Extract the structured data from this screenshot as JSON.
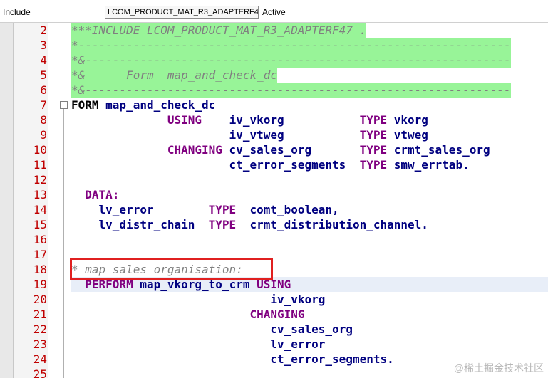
{
  "header": {
    "label": "Include",
    "include_name": "LCOM_PRODUCT_MAT_R3_ADAPTERF47",
    "status": "Active"
  },
  "lines": [
    {
      "num": "2",
      "segments": [
        {
          "t": "***INCLUDE LCOM_PRODUCT_MAT_R3_ADAPTERF47 .",
          "c": "cm"
        }
      ]
    },
    {
      "num": "3",
      "segments": [
        {
          "t": "*---------------------------------------------------------------",
          "c": "cm"
        }
      ]
    },
    {
      "num": "4",
      "segments": [
        {
          "t": "*&--------------------------------------------------------------",
          "c": "cm"
        }
      ]
    },
    {
      "num": "5",
      "segments": [
        {
          "t": "*&      Form  map_and_check_dc",
          "c": "cm"
        }
      ]
    },
    {
      "num": "6",
      "segments": [
        {
          "t": "*&--------------------------------------------------------------",
          "c": "cm"
        }
      ]
    },
    {
      "num": "7",
      "segments": [
        {
          "t": "FORM",
          "c": "kwb"
        },
        {
          "t": " map_and_check_dc",
          "c": "id"
        }
      ]
    },
    {
      "num": "8",
      "segments": [
        {
          "t": "              USING",
          "c": "kw"
        },
        {
          "t": "    iv_vkorg           ",
          "c": "id"
        },
        {
          "t": "TYPE",
          "c": "kw"
        },
        {
          "t": " vkorg",
          "c": "id"
        }
      ]
    },
    {
      "num": "9",
      "segments": [
        {
          "t": "                       iv_vtweg           ",
          "c": "id"
        },
        {
          "t": "TYPE",
          "c": "kw"
        },
        {
          "t": " vtweg",
          "c": "id"
        }
      ]
    },
    {
      "num": "10",
      "segments": [
        {
          "t": "              CHANGING",
          "c": "kw"
        },
        {
          "t": " cv_sales_org       ",
          "c": "id"
        },
        {
          "t": "TYPE",
          "c": "kw"
        },
        {
          "t": " crmt_sales_org",
          "c": "id"
        }
      ]
    },
    {
      "num": "11",
      "segments": [
        {
          "t": "                       ct_error_segments  ",
          "c": "id"
        },
        {
          "t": "TYPE",
          "c": "kw"
        },
        {
          "t": " smw_errtab.",
          "c": "id"
        }
      ]
    },
    {
      "num": "12",
      "segments": []
    },
    {
      "num": "13",
      "segments": [
        {
          "t": "  DATA:",
          "c": "kw"
        }
      ]
    },
    {
      "num": "14",
      "segments": [
        {
          "t": "    lv_error        ",
          "c": "id"
        },
        {
          "t": "TYPE",
          "c": "kw"
        },
        {
          "t": "  comt_boolean,",
          "c": "id"
        }
      ]
    },
    {
      "num": "15",
      "segments": [
        {
          "t": "    lv_distr_chain  ",
          "c": "id"
        },
        {
          "t": "TYPE",
          "c": "kw"
        },
        {
          "t": "  crmt_distribution_channel.",
          "c": "id"
        }
      ]
    },
    {
      "num": "16",
      "segments": []
    },
    {
      "num": "17",
      "segments": []
    },
    {
      "num": "18",
      "segments": [
        {
          "t": "* map sales organisation:",
          "c": "cm"
        }
      ]
    },
    {
      "num": "19",
      "segments": [
        {
          "t": "  PERFORM",
          "c": "kw"
        },
        {
          "t": " map_vkorg_to_crm ",
          "c": "id"
        },
        {
          "t": "USING",
          "c": "kw"
        }
      ]
    },
    {
      "num": "20",
      "segments": [
        {
          "t": "                             iv_vkorg",
          "c": "id"
        }
      ]
    },
    {
      "num": "21",
      "segments": [
        {
          "t": "                          CHANGING",
          "c": "kw"
        }
      ]
    },
    {
      "num": "22",
      "segments": [
        {
          "t": "                             cv_sales_org",
          "c": "id"
        }
      ]
    },
    {
      "num": "23",
      "segments": [
        {
          "t": "                             lv_error",
          "c": "id"
        }
      ]
    },
    {
      "num": "24",
      "segments": [
        {
          "t": "                             ct_error_segments.",
          "c": "id"
        }
      ]
    },
    {
      "num": "25",
      "segments": []
    }
  ],
  "watermark": "@稀土掘金技术社区"
}
